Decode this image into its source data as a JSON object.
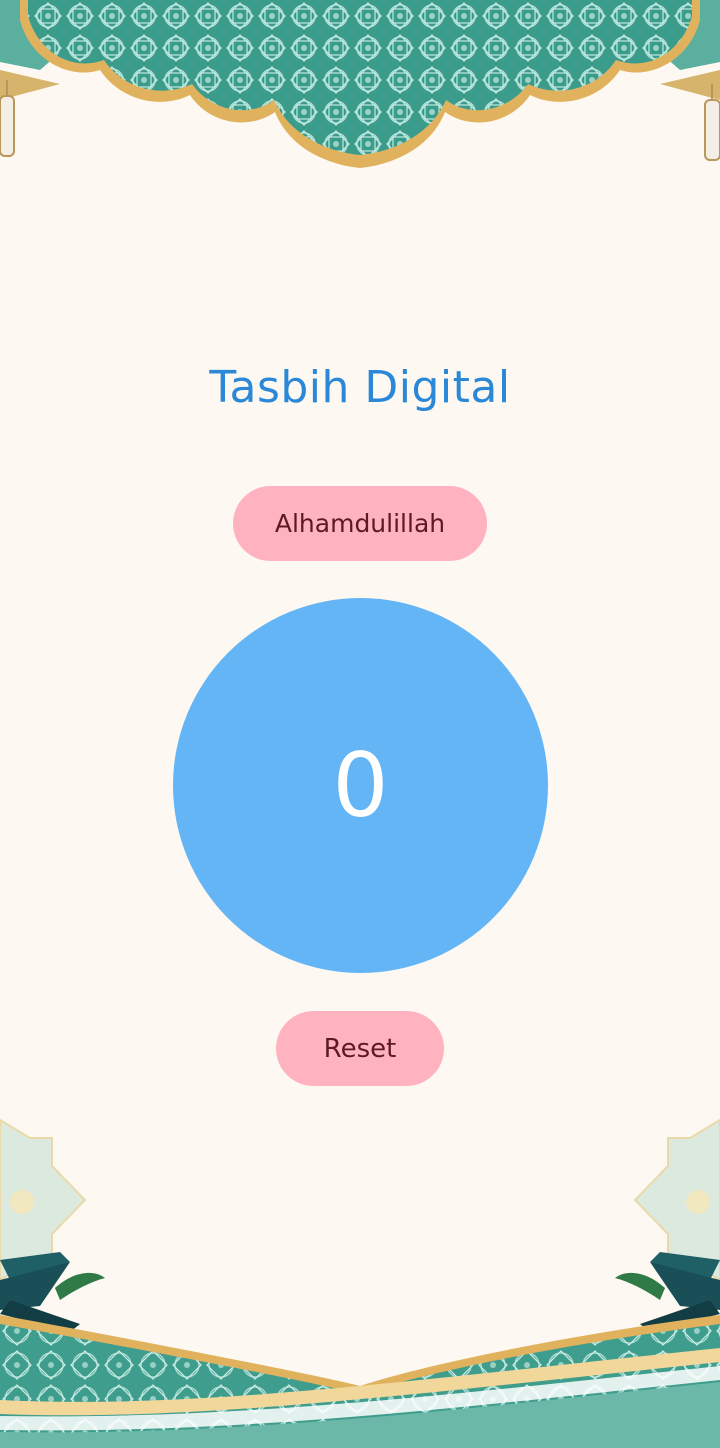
{
  "app": {
    "title": "Tasbih Digital"
  },
  "dhikr": {
    "label": "Alhamdulillah"
  },
  "counter": {
    "value": "0"
  },
  "reset": {
    "label": "Reset"
  },
  "colors": {
    "background": "#fdf8f1",
    "title": "#2b88d8",
    "pill_bg": "#ffb3c1",
    "pill_text": "#5c1a23",
    "circle": "#64b5f6",
    "teal": "#3c9c8c",
    "teal_dark": "#1f6f68",
    "gold": "#e0b25d",
    "mint": "#dce9de"
  },
  "decor": {
    "top": "islamic-arch-pattern-icon",
    "left_lantern": "lantern-icon",
    "right_lantern": "lantern-icon",
    "bottom": "quran-stand-and-pattern-icon"
  }
}
